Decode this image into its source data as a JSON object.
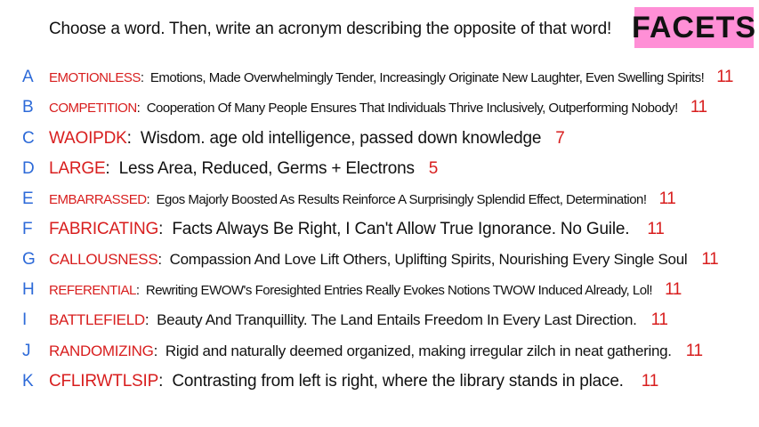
{
  "prompt": "Choose a word. Then, write an acronym describing the opposite of that word!",
  "badge": "FACETS",
  "entries": [
    {
      "letter": "A",
      "word": "EMOTIONLESS",
      "text": "Emotions, Made Overwhelmingly Tender, Increasingly Originate New Laughter, Even Swelling Spirits!",
      "score": "11"
    },
    {
      "letter": "B",
      "word": "COMPETITION",
      "text": "Cooperation Of Many People Ensures That Individuals Thrive Inclusively, Outperforming Nobody!",
      "score": "11"
    },
    {
      "letter": "C",
      "word": "WAOIPDK",
      "text": "Wisdom. age old intelligence, passed down knowledge",
      "score": "7"
    },
    {
      "letter": "D",
      "word": "LARGE",
      "text": "Less Area, Reduced, Germs + Electrons",
      "score": "5"
    },
    {
      "letter": "E",
      "word": "EMBARRASSED",
      "text": "Egos Majorly Boosted As Results Reinforce A Surprisingly Splendid Effect, Determination!",
      "score": "11"
    },
    {
      "letter": "F",
      "word": "FABRICATING",
      "text": "Facts Always Be Right, I Can't Allow True Ignorance. No Guile.",
      "score": "11"
    },
    {
      "letter": "G",
      "word": "CALLOUSNESS",
      "text": "Compassion And Love Lift Others, Uplifting Spirits, Nourishing Every Single Soul",
      "score": "11"
    },
    {
      "letter": "H",
      "word": "REFERENTIAL",
      "text": "Rewriting EWOW's Foresighted Entries Really Evokes Notions TWOW Induced Already, Lol!",
      "score": "11"
    },
    {
      "letter": "I",
      "word": "BATTLEFIELD",
      "text": "Beauty And Tranquillity. The Land Entails Freedom In Every Last Direction.",
      "score": "11"
    },
    {
      "letter": "J",
      "word": "RANDOMIZING",
      "text": "Rigid and naturally deemed organized, making irregular zilch in neat gathering.",
      "score": "11"
    },
    {
      "letter": "K",
      "word": "CFLIRWTLSIP",
      "text": "Contrasting from left is right, where the library stands in place.",
      "score": "11"
    }
  ]
}
